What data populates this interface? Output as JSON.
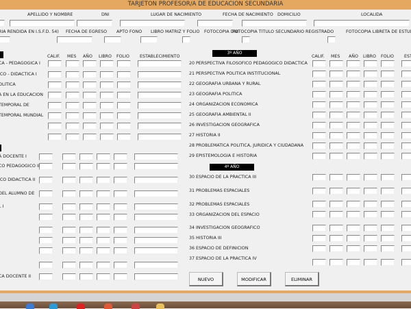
{
  "title": "TARJETON PROFESOR/A DE EDUCACION SECUNDARIA",
  "header_fields": [
    "APELLIDO Y NOMBRE",
    "DNI",
    "LUGAR DE NACIMIENTO",
    "FECHA DE NACIMIENTO",
    "DOMICILIO",
    "LOCALIDA"
  ],
  "second_fields": [
    "RIA RENDIDA EN I.S.F.D. 54)",
    "FECHA DE EGRESO",
    "APTO FONO",
    "LIBRO MATRIZ Y FOLIO",
    "FOTOCOPIA DNI",
    "FOTOCOPIA TITULO SECUNDARIO REGISTRADO",
    "FOTOCOPIA LIBRETA DE ESTUD"
  ],
  "columns": [
    "CALIF.",
    "MES",
    "AÑO",
    "LIBRO",
    "FOLIO",
    "ESTABLECIMIENTO"
  ],
  "right_columns_partial": "EST",
  "left_subjects_1": [
    "CA - PEDAGOGICA I",
    "ICO - DIDACTICA I",
    "OLITICA",
    "A EN LA EDUCACION",
    "TEMPORAL DE",
    "TEMPORAL MUNDIAL",
    "",
    ""
  ],
  "left_subjects_2": [
    "A DOCENTE I",
    "CO PEDAGOGICO II",
    "ICO DIDACTICA II",
    "DEL ALUMNO DE",
    "L I",
    "",
    "",
    "",
    "",
    "",
    "CA DOCENTE II"
  ],
  "year3": "3º AÑO",
  "year4": "4º AÑO",
  "subjects_3": [
    "20 PERSPECTIVA FILOSOFICO PEDAGOGICO DIDACTICA",
    "21 PERSPECTIVA POLITICA INSTITUCIONAL",
    "22 GEOGRAFIA URBANA Y RURAL",
    "23 GEOGRAFIA POLITICA",
    "24 ORGANIZACION ECONOMICA",
    "25 GEOGRAFIA AMBIENTAL II",
    "26 INVESTIGACION GEOGRAFICA",
    "27 HISTORIA II",
    "28 PROBLEMATICA POLITICA, JURIDICA Y CIUDADANA",
    "29 EPISTEMOLOGIA E HISTORIA"
  ],
  "subjects_4": [
    "30 ESPACIO DE LA PRACTICA III",
    "31 PROBLEMAS ESPACIALES",
    "32 PROBLEMAS ESPACIALES",
    "33 ORGANIZACION DEL ESPACIO",
    "34 INVESTIGACION GEOGRAFICO",
    "35 HISTORIA III",
    "36 ESPACIO DE DEFINICION",
    "37 ESPACIO DE LA PRACTICA IV"
  ],
  "buttons": {
    "new": "NUEVO",
    "modify": "MODIFICAR",
    "delete": "ELIMINAR"
  }
}
